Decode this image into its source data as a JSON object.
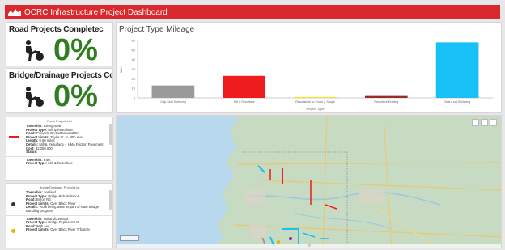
{
  "app": {
    "title": "OCRC Infrastructure Project Dashboard",
    "brand_color": "#d9282e"
  },
  "indicators": [
    {
      "title": "Road Projects Completec",
      "value": "0%",
      "icon": "worker-roller-icon"
    },
    {
      "title": "Bridge/Drainage Projects Complete",
      "value": "0%",
      "icon": "worker-roller-icon"
    }
  ],
  "chart_panel": {
    "title": "Project Type Mileage"
  },
  "chart_data": {
    "type": "bar",
    "title": "Project Type Mileage",
    "xlabel": "Project Type",
    "ylabel": "Miles",
    "categories": [
      "Chip Seal Surfacing",
      "Mill & Resurface",
      "Reconstruct or Crush & Shape",
      "Resurface Existing",
      "Seal Coat Surfacing"
    ],
    "values": [
      13,
      23,
      1,
      2,
      58
    ],
    "colors": [
      "#9a9a9a",
      "#ee1c1c",
      "#f2e33a",
      "#9b2a2a",
      "#17c0f5"
    ],
    "ylim": [
      0,
      60
    ],
    "yticks": [
      0,
      10,
      20,
      30,
      40,
      50,
      60
    ],
    "grid": false
  },
  "road_list": {
    "header": "Road Project List",
    "entries": [
      {
        "township": "Georgetown",
        "type": "Mill & Resurface",
        "road": "Pinnacle Dr./Cottonwood Dr.",
        "limits": "Taylor St. to 48th Ave.",
        "length": "0.80 miles",
        "details": "Mill & Resurface + HMA Friction Pavement",
        "cost": "$2,250,000",
        "status": "",
        "marker_color": "#ee1c1c"
      },
      {
        "township": "Park",
        "type": "Mill & Resurface",
        "marker_color": "#ee1c1c"
      }
    ]
  },
  "bridge_list": {
    "header": "Bridge/Drainage Project List",
    "entries": [
      {
        "township": "Zeeland",
        "type": "Bridge Rehabilitation",
        "road": "Byron Rd.",
        "limits": "Over Black River",
        "details": "Work being done as part of state Bridge Bundling program",
        "marker_color": "#333333"
      },
      {
        "township": "Holland/Zeeland",
        "type": "Bridge Replacement",
        "road": "96th Ave.",
        "limits": "Over Black River Tributary",
        "marker_color": "#e6b400"
      }
    ]
  },
  "labels": {
    "township": "Township:",
    "type": "Project Type:",
    "road": "Road:",
    "limits": "Project Limits:",
    "length": "Length:",
    "details": "Details:",
    "cost": "Cost:",
    "status": "Status:"
  }
}
